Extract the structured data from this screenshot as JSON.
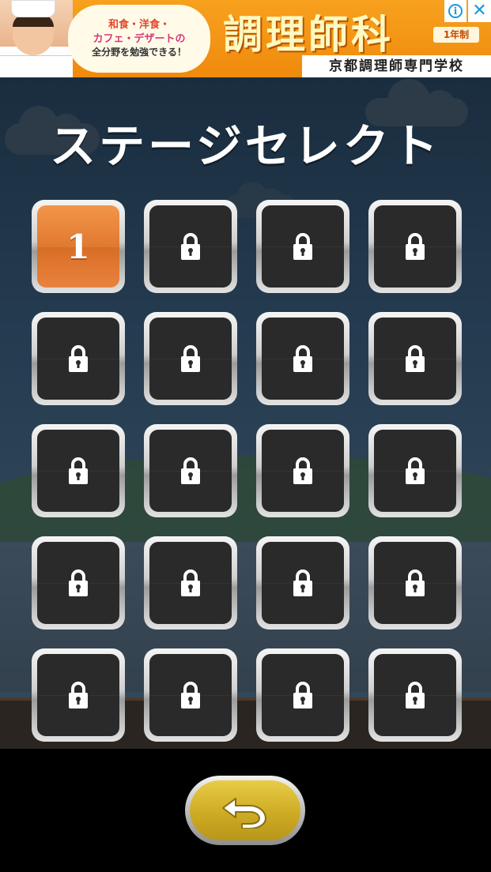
{
  "ad": {
    "bubble_line1": "和食・洋食・",
    "bubble_line2": "カフェ・デザートの",
    "bubble_line3": "全分野を勉強できる！",
    "title": "調理師科",
    "badge": "1年制",
    "school": "京都調理師専門学校",
    "info_icon": "info-icon",
    "close_icon": "close-icon"
  },
  "page": {
    "title": "ステージセレクト"
  },
  "stages": [
    {
      "label": "1",
      "locked": false
    },
    {
      "label": "",
      "locked": true
    },
    {
      "label": "",
      "locked": true
    },
    {
      "label": "",
      "locked": true
    },
    {
      "label": "",
      "locked": true
    },
    {
      "label": "",
      "locked": true
    },
    {
      "label": "",
      "locked": true
    },
    {
      "label": "",
      "locked": true
    },
    {
      "label": "",
      "locked": true
    },
    {
      "label": "",
      "locked": true
    },
    {
      "label": "",
      "locked": true
    },
    {
      "label": "",
      "locked": true
    },
    {
      "label": "",
      "locked": true
    },
    {
      "label": "",
      "locked": true
    },
    {
      "label": "",
      "locked": true
    },
    {
      "label": "",
      "locked": true
    },
    {
      "label": "",
      "locked": true
    },
    {
      "label": "",
      "locked": true
    },
    {
      "label": "",
      "locked": true
    },
    {
      "label": "",
      "locked": true
    }
  ],
  "back_button": {
    "icon": "back-arrow-icon"
  },
  "colors": {
    "unlocked_tile": "#e07a30",
    "locked_tile": "#2a2a2a",
    "back_button": "#cfab24",
    "ad_background": "#f39a18"
  }
}
